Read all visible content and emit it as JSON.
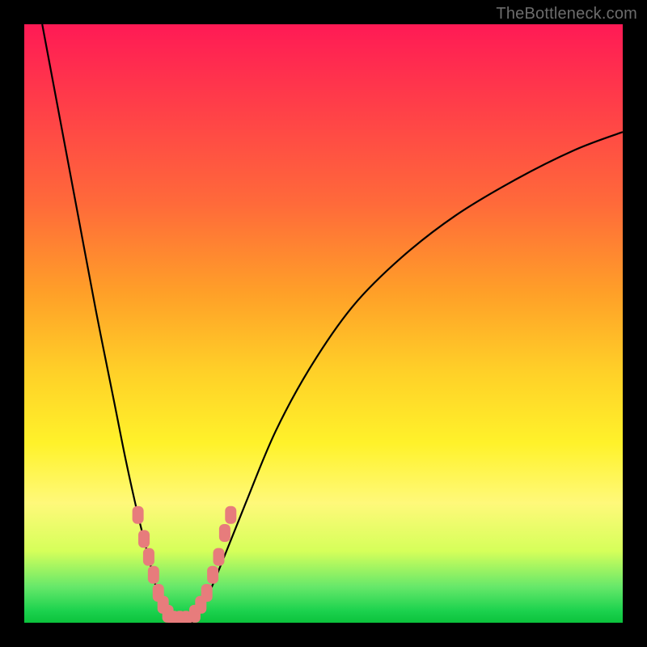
{
  "watermark": "TheBottleneck.com",
  "chart_data": {
    "type": "line",
    "title": "",
    "xlabel": "",
    "ylabel": "",
    "xlim": [
      0,
      100
    ],
    "ylim": [
      0,
      100
    ],
    "series": [
      {
        "name": "left-curve",
        "x": [
          3,
          6,
          9,
          12,
          15,
          17,
          19,
          21,
          22,
          23,
          24,
          25
        ],
        "values": [
          100,
          84,
          68,
          52,
          37,
          27,
          18,
          10,
          6,
          3,
          1,
          0
        ]
      },
      {
        "name": "right-curve",
        "x": [
          28,
          30,
          33,
          37,
          42,
          48,
          55,
          63,
          72,
          82,
          92,
          100
        ],
        "values": [
          0,
          3,
          10,
          20,
          32,
          43,
          53,
          61,
          68,
          74,
          79,
          82
        ]
      }
    ],
    "markers": [
      {
        "series": "left-curve",
        "x": 19.0,
        "y": 18
      },
      {
        "series": "left-curve",
        "x": 20.0,
        "y": 14
      },
      {
        "series": "left-curve",
        "x": 20.8,
        "y": 11
      },
      {
        "series": "left-curve",
        "x": 21.6,
        "y": 8
      },
      {
        "series": "left-curve",
        "x": 22.4,
        "y": 5
      },
      {
        "series": "left-curve",
        "x": 23.2,
        "y": 3
      },
      {
        "series": "left-curve",
        "x": 24.0,
        "y": 1.5
      },
      {
        "series": "valley",
        "x": 25.0,
        "y": 0.5
      },
      {
        "series": "valley",
        "x": 26.0,
        "y": 0.5
      },
      {
        "series": "valley",
        "x": 27.0,
        "y": 0.5
      },
      {
        "series": "right-curve",
        "x": 28.5,
        "y": 1.5
      },
      {
        "series": "right-curve",
        "x": 29.5,
        "y": 3
      },
      {
        "series": "right-curve",
        "x": 30.5,
        "y": 5
      },
      {
        "series": "right-curve",
        "x": 31.5,
        "y": 8
      },
      {
        "series": "right-curve",
        "x": 32.5,
        "y": 11
      },
      {
        "series": "right-curve",
        "x": 33.5,
        "y": 15
      },
      {
        "series": "right-curve",
        "x": 34.5,
        "y": 18
      }
    ],
    "gradient_colors": {
      "top": "#ff1a55",
      "mid": "#ffd028",
      "bottom": "#0bc23c"
    }
  }
}
